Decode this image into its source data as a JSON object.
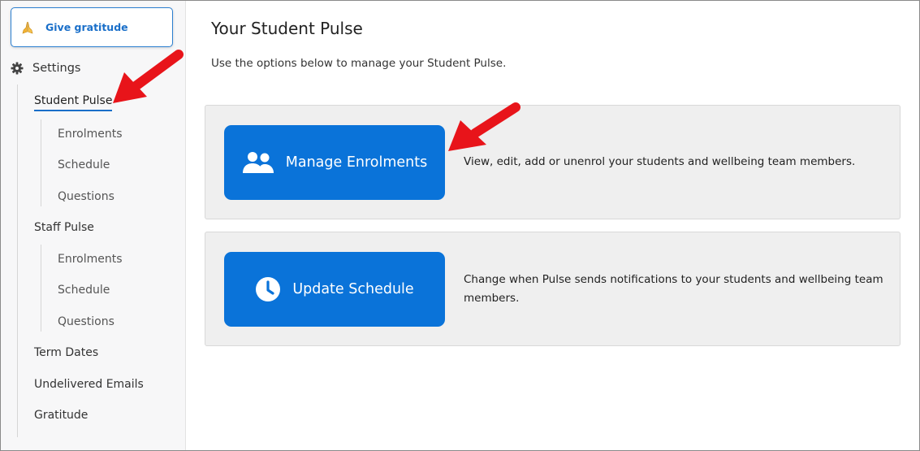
{
  "sidebar": {
    "give_gratitude": {
      "label": "Give gratitude",
      "icon": "praying-hands-icon"
    },
    "settings": {
      "label": "Settings",
      "icon": "gear-icon"
    },
    "student_pulse": {
      "label": "Student Pulse",
      "items": [
        "Enrolments",
        "Schedule",
        "Questions"
      ]
    },
    "staff_pulse": {
      "label": "Staff Pulse",
      "items": [
        "Enrolments",
        "Schedule",
        "Questions"
      ]
    },
    "term_dates": "Term Dates",
    "undelivered_emails": "Undelivered Emails",
    "gratitude": "Gratitude"
  },
  "main": {
    "title": "Your Student Pulse",
    "description": "Use the options below to manage your Student Pulse.",
    "cards": [
      {
        "button_label": "Manage Enrolments",
        "icon": "users-icon",
        "text": "View, edit, add or unenrol your students and wellbeing team members."
      },
      {
        "button_label": "Update Schedule",
        "icon": "clock-icon",
        "text": "Change when Pulse sends notifications to your students and wellbeing team members."
      }
    ]
  },
  "colors": {
    "accent": "#0a73d9",
    "annotation_arrow": "#e8141a",
    "card_bg": "#efefef",
    "sidebar_bg": "#f7f7f8"
  }
}
